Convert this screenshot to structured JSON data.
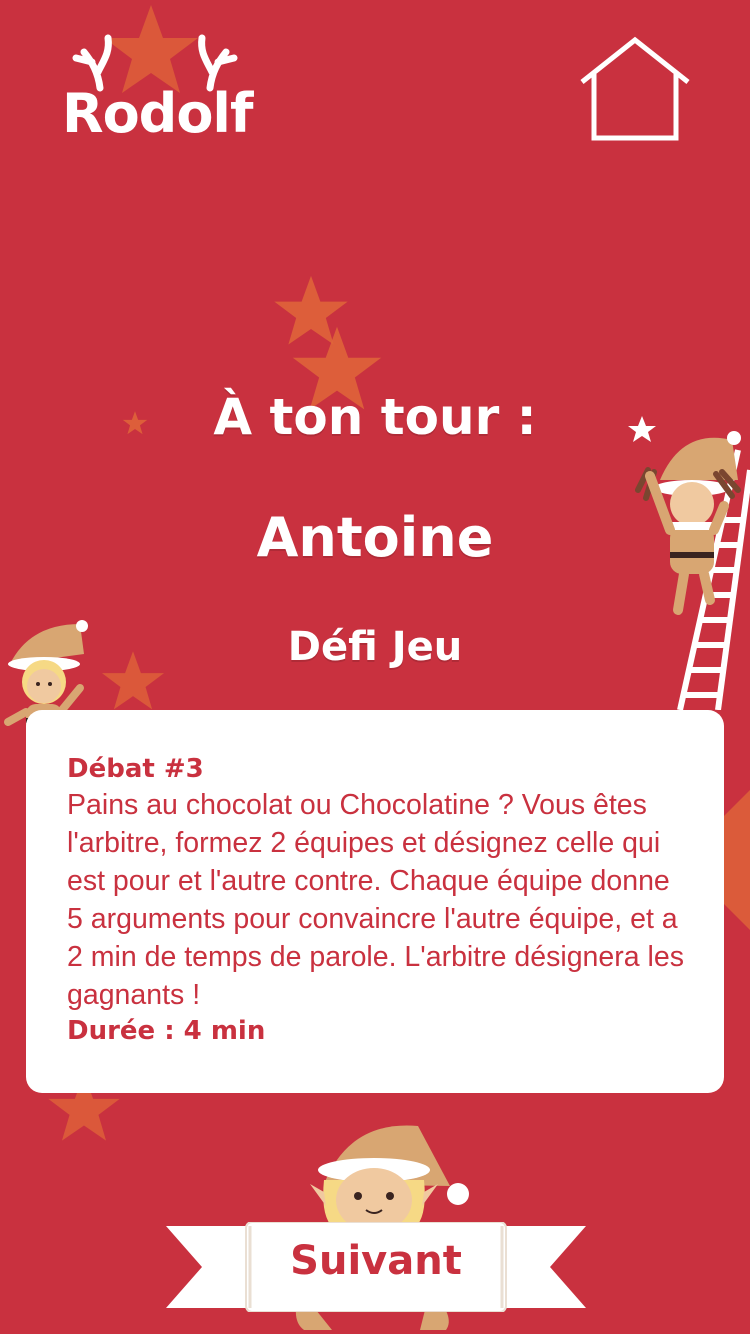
{
  "app": {
    "logo_text": "Rodolf"
  },
  "header": {
    "home_icon": "home-icon"
  },
  "turn": {
    "label": "À ton tour :",
    "player_name": "Antoine",
    "category": "Défi Jeu"
  },
  "challenge": {
    "title": "Débat #3",
    "description": "Pains au chocolat ou Chocolatine ? Vous êtes l'arbitre, formez 2 équipes et désignez celle qui est pour et l'autre contre. Chaque équipe donne 5 arguments pour convaincre l'autre équipe, et a 2 min de temps de parole. L'arbitre désignera les gagnants !",
    "duration": "Durée : 4 min"
  },
  "footer": {
    "next_label": "Suivant"
  },
  "colors": {
    "background": "#c9313f",
    "text_on_bg": "#ffffff",
    "card": "#ffffff",
    "accent": "#c9313f",
    "star": "#e0663a"
  }
}
